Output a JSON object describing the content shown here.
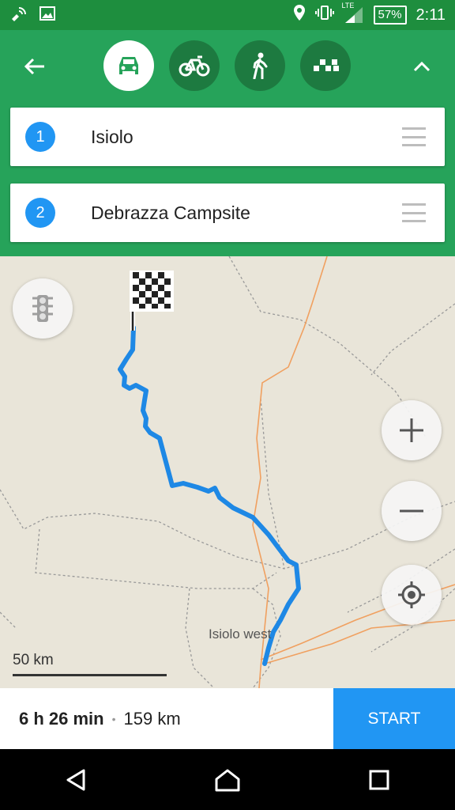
{
  "status_bar": {
    "network": "LTE",
    "battery": "57%",
    "time": "2:11"
  },
  "header": {
    "modes": [
      {
        "name": "car",
        "active": true
      },
      {
        "name": "bicycle",
        "active": false
      },
      {
        "name": "pedestrian",
        "active": false
      },
      {
        "name": "taxi",
        "active": false
      }
    ]
  },
  "route_points": [
    {
      "number": "1",
      "label": "Isiolo"
    },
    {
      "number": "2",
      "label": "Debrazza Campsite"
    }
  ],
  "map": {
    "place_label": "Isiolo west",
    "scale_label": "50 km",
    "route_color": "#1e88e5",
    "road_color": "#f0a060"
  },
  "route_summary": {
    "duration": "6 h 26 min",
    "separator": "•",
    "distance": "159 km",
    "start_label": "START"
  },
  "colors": {
    "header_bg": "#26a35a",
    "accent_blue": "#2196f3"
  }
}
